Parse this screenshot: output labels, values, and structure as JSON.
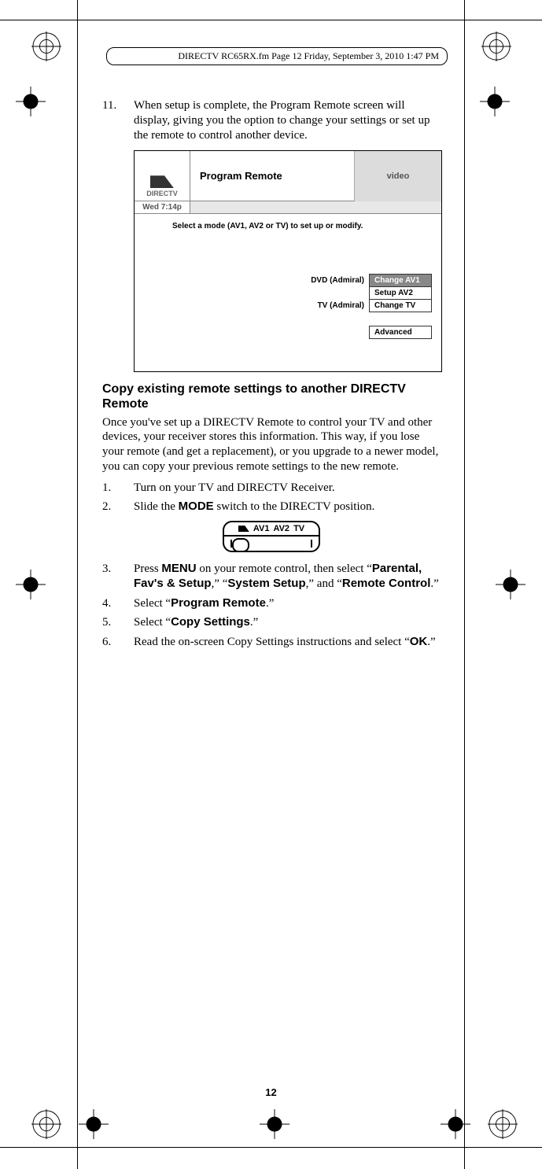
{
  "header": "DIRECTV RC65RX.fm  Page 12  Friday, September 3, 2010  1:47 PM",
  "step11": {
    "num": "11.",
    "text": "When setup is complete, the Program Remote screen will display, giving you the option to change your settings or set up the remote to control another device."
  },
  "screenshot": {
    "logo_text": "DIRECTV",
    "title": "Program Remote",
    "video": "video",
    "time": "Wed 7:14p",
    "instruction": "Select a mode (AV1, AV2 or TV) to set up or modify.",
    "dvd_label": "DVD (Admiral)",
    "tv_label": "TV (Admiral)",
    "btn_change_av1": "Change AV1",
    "btn_setup_av2": "Setup AV2",
    "btn_change_tv": "Change TV",
    "btn_advanced": "Advanced"
  },
  "section_heading": "Copy existing remote settings to another DIRECTV Remote",
  "intro_para": "Once you've set up a DIRECTV Remote to control your TV and other devices, your receiver stores this information. This way, if you lose your remote (and get a replacement), or you upgrade to a newer model, you can copy your previous remote settings to the new remote.",
  "steps": {
    "s1": {
      "num": "1.",
      "text": "Turn on your TV and DIRECTV Receiver."
    },
    "s2": {
      "num": "2.",
      "pre": "Slide the ",
      "bold": "MODE",
      "post": " switch to the DIRECTV position."
    },
    "s3": {
      "num": "3.",
      "pre": "Press ",
      "b1": "MENU",
      "mid1": " on your remote control, then select “",
      "b2": "Parental, Fav's & Setup",
      "mid2": ",” “",
      "b3": "System Setup",
      "mid3": ",” and “",
      "b4": "Remote Control",
      "post": ".”"
    },
    "s4": {
      "num": "4.",
      "pre": "Select “",
      "b1": "Program Remote",
      "post": ".”"
    },
    "s5": {
      "num": "5.",
      "pre": "Select “",
      "b1": "Copy Settings",
      "post": ".”"
    },
    "s6": {
      "num": "6.",
      "pre": "Read the on-screen Copy Settings instructions and select “",
      "b1": "OK",
      "post": ".”"
    }
  },
  "mode_labels": {
    "av1": "AV1",
    "av2": "AV2",
    "tv": "TV"
  },
  "page_number": "12"
}
